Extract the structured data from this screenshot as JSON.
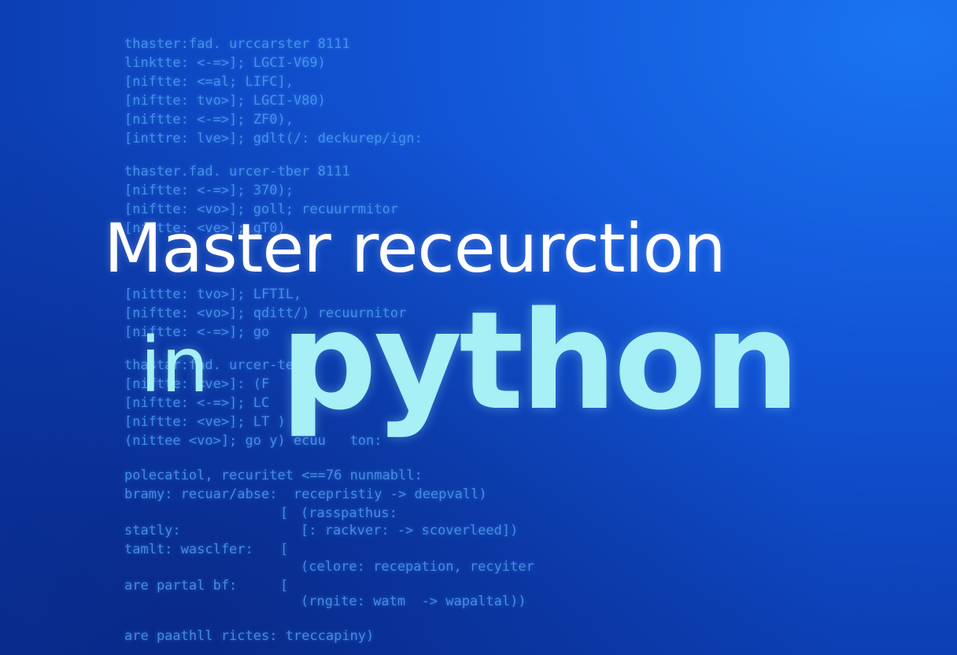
{
  "code_background": {
    "block1": [
      "thaster:fad. urccarster 8111",
      "linktte: <-=>]; LGCI-V69)",
      "[niftte: <=al; LIFC],",
      "[niftte: tvo>]; LGCI-V80)",
      "[niftte: <-=>]; ZF0),",
      "[inttre: lve>]; gdlt(/: deckurep/ign:"
    ],
    "block2": [
      "thaster.fad. urcer-tber 8111",
      "[niftte: <-=>]; 370);",
      "[niftte: <vo>]; goll; recuurrmitor",
      "[niftte: <ve>]; gT0)",
      "",
      "",
      "[nittte: tvo>]; LFTIL,",
      "[niftte: <vo>]; qditt/) recuurnitor",
      "[niftte: <-=>]; go"
    ],
    "block3": [
      "thastar:fad. urcer-ter",
      "[niftte: <ve>]: (F",
      "[niftte: <-=>]; LC",
      "[niftte: <ve>]; LT )",
      "(nittee <vo>]; go y) ecuu   ton:"
    ],
    "block4": [
      "polecatiol, recuritet <==76 nunmabll:",
      "bramy: recuar/abse:  recepristiy -> deepvall)"
    ],
    "block4_right": [
      "(rasspathus:",
      "[: rackver: -> scoverleed])",
      "",
      "(celore: recepation, recyiter",
      "",
      "(rngite: watm  -> wapaltal))"
    ],
    "block4_left": [
      "statly:",
      "tamlt: wasclfer:",
      "",
      "are partal bf:"
    ],
    "bars": [
      "[",
      "[",
      "[",
      "["
    ],
    "footer": "are paathll rictes: treccapiny)"
  },
  "headline": {
    "line1": "Master receurction",
    "line2_small": "in",
    "line2_large": "python"
  },
  "colors": {
    "background_top_right": "#1a74f0",
    "background_bottom_left": "#0a34a0",
    "code_text": "#4fa0f2",
    "headline_white": "#ffffff",
    "python_cyan": "#a6f0f6"
  }
}
